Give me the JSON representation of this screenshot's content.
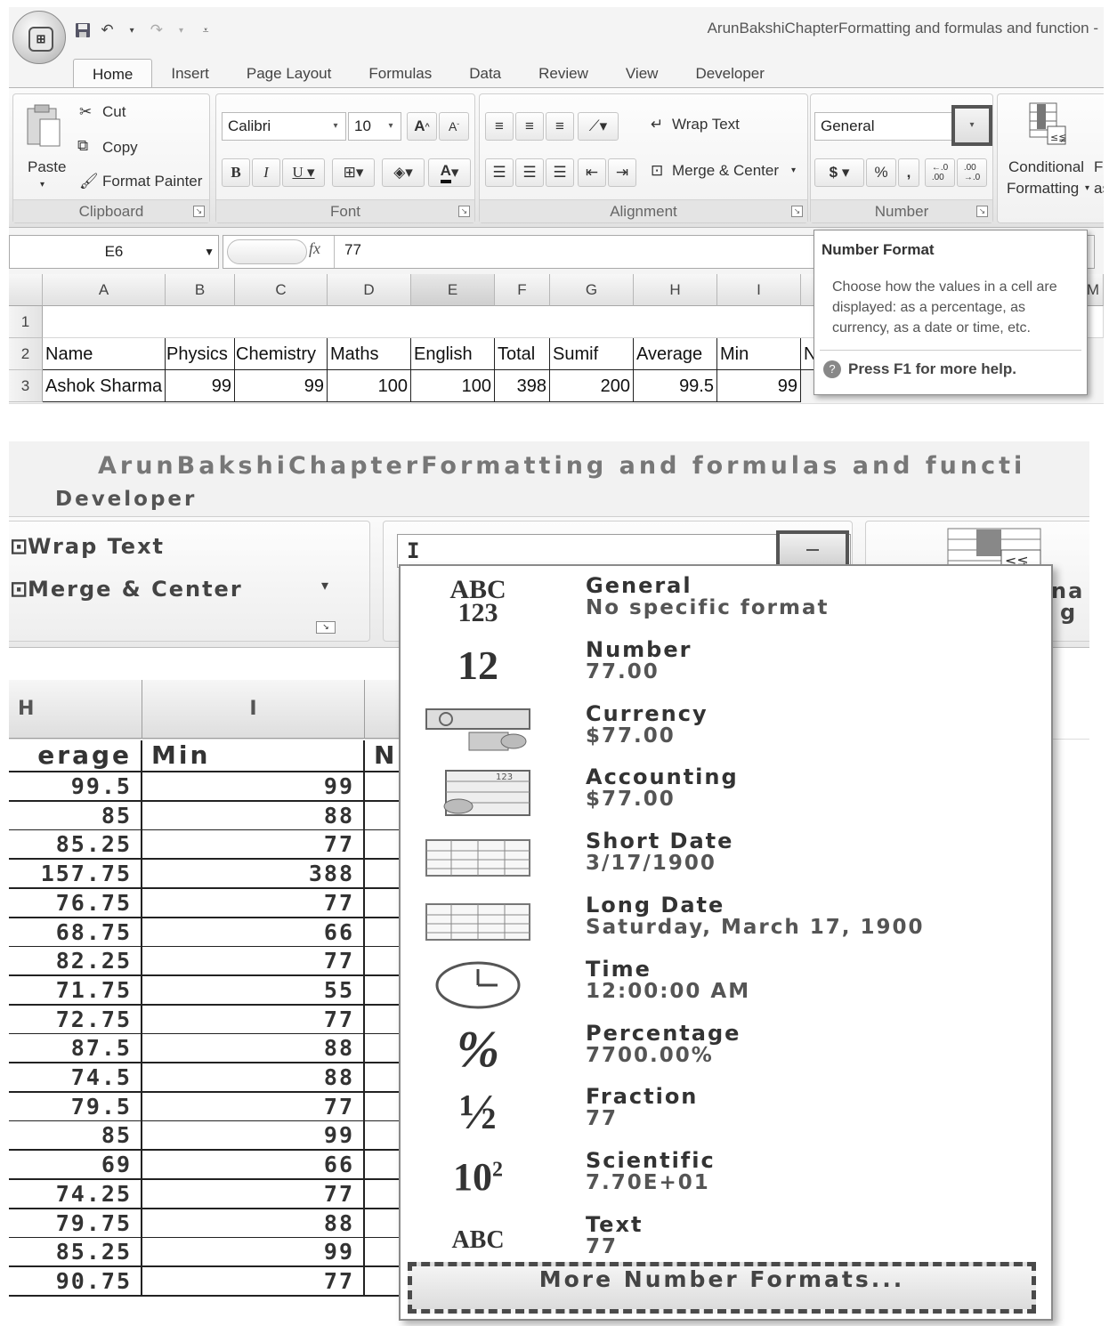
{
  "top": {
    "title": "ArunBakshiChapterFormatting and formulas and function -",
    "tabs": [
      "Home",
      "Insert",
      "Page Layout",
      "Formulas",
      "Data",
      "Review",
      "View",
      "Developer"
    ],
    "clipboard": {
      "paste": "Paste",
      "cut": "Cut",
      "copy": "Copy",
      "format_painter": "Format Painter",
      "label": "Clipboard"
    },
    "font": {
      "name": "Calibri",
      "size": "10",
      "label": "Font"
    },
    "alignment": {
      "wrap_text": "Wrap Text",
      "merge_center": "Merge & Center",
      "label": "Alignment"
    },
    "number": {
      "format": "General",
      "label": "Number",
      "dollar": "$",
      "percent": "%",
      "comma": ","
    },
    "styles": {
      "conditional_line1": "Conditional",
      "conditional_line2": "Formatting",
      "cut_f": "F",
      "cut_as": "as"
    },
    "formula_bar": {
      "cell_ref": "E6",
      "fx": "fx",
      "value": "77"
    },
    "columns": [
      "A",
      "B",
      "C",
      "D",
      "E",
      "F",
      "G",
      "H",
      "I",
      "M"
    ],
    "row_numbers": [
      "1",
      "2",
      "3"
    ],
    "header_row": [
      "Name",
      "Physics",
      "Chemistry",
      "Maths",
      "English",
      "Total",
      "Sumif",
      "Average",
      "Min",
      "N"
    ],
    "data_row": [
      "Ashok Sharma",
      "99",
      "99",
      "100",
      "100",
      "398",
      "200",
      "99.5",
      "99"
    ],
    "tooltip": {
      "title": "Number Format",
      "body": "Choose how the values in a cell are displayed: as a percentage, as currency, as a date or time, etc.",
      "help": "Press F1 for more help."
    }
  },
  "bottom": {
    "title": "ArunBakshiChapterFormatting and formulas and functi",
    "developer_tab": "Developer",
    "wrap_text": "Wrap Text",
    "merge_center": "Merge & Center",
    "cut_text_1": "na",
    "cut_text_2": "g",
    "combo_value": "I",
    "col_headers": [
      "H",
      "I"
    ],
    "col_header_cut": "N",
    "header_average": "erage",
    "header_min": "Min",
    "averages": [
      "99.5",
      "85",
      "85.25",
      "157.75",
      "76.75",
      "68.75",
      "82.25",
      "71.75",
      "72.75",
      "87.5",
      "74.5",
      "79.5",
      "85",
      "69",
      "74.25",
      "79.75",
      "85.25",
      "90.75"
    ],
    "mins": [
      "99",
      "88",
      "77",
      "388",
      "77",
      "66",
      "77",
      "55",
      "77",
      "88",
      "88",
      "77",
      "99",
      "66",
      "77",
      "88",
      "99",
      "77"
    ],
    "formats": [
      {
        "name": "General",
        "sample": "No specific format",
        "icon": "abc-123-icon"
      },
      {
        "name": "Number",
        "sample": "77.00",
        "icon": "number-12-icon"
      },
      {
        "name": "Currency",
        "sample": "$77.00",
        "icon": "currency-icon"
      },
      {
        "name": "Accounting",
        "sample": " $77.00",
        "icon": "accounting-icon"
      },
      {
        "name": "Short Date",
        "sample": "3/17/1900",
        "icon": "short-date-calendar-icon"
      },
      {
        "name": "Long Date",
        "sample": "Saturday, March 17, 1900",
        "icon": "long-date-calendar-icon"
      },
      {
        "name": "Time",
        "sample": "12:00:00 AM",
        "icon": "clock-icon"
      },
      {
        "name": "Percentage",
        "sample": "7700.00%",
        "icon": "percent-icon"
      },
      {
        "name": "Fraction",
        "sample": "77",
        "icon": "fraction-icon"
      },
      {
        "name": "Scientific",
        "sample": "7.70E+01",
        "icon": "scientific-icon"
      },
      {
        "name": "Text",
        "sample": "77",
        "icon": "abc-text-icon"
      }
    ],
    "icon_glyphs": {
      "general_top": "ABC",
      "general_bottom": "123",
      "number": "12",
      "percent": "%",
      "fraction": "½",
      "sci_base": "10",
      "sci_exp": "2",
      "text": "ABC",
      "cal_label": "123"
    },
    "more_formats": "More Number Formats..."
  }
}
